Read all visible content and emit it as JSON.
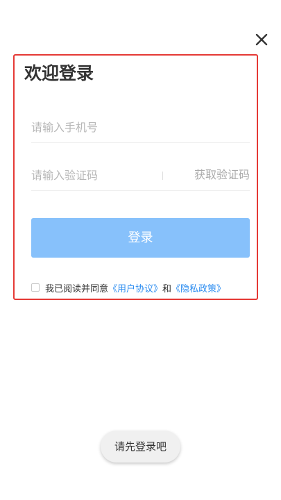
{
  "header": {
    "close_icon": "close-icon"
  },
  "login": {
    "title": "欢迎登录",
    "phone_placeholder": "请输入手机号",
    "code_placeholder": "请输入验证码",
    "get_code_label": "获取验证码",
    "submit_label": "登录"
  },
  "agreement": {
    "checked": false,
    "prefix": "我已阅读并同意",
    "user_agreement": "《用户协议》",
    "conjunction": "和",
    "privacy_policy": "《隐私政策》"
  },
  "toast": {
    "message": "请先登录吧"
  },
  "colors": {
    "highlight_border": "#e53935",
    "button_bg": "#87c1fb",
    "link": "#2b8cf0",
    "placeholder": "#b8b8b8"
  }
}
